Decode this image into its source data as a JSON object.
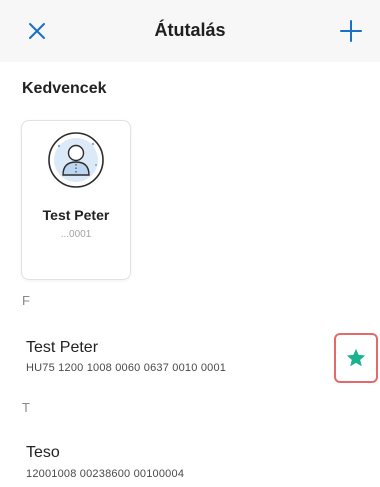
{
  "header": {
    "title": "Átutalás",
    "close_icon": "close-icon",
    "add_icon": "plus-icon",
    "accent_color": "#1a6fc7"
  },
  "favorites": {
    "title": "Kedvencek",
    "items": [
      {
        "name": "Test Peter",
        "account": "...0001",
        "icon": "person-avatar-icon"
      }
    ]
  },
  "contacts": [
    {
      "letter": "F",
      "name": "Test Peter",
      "account": "HU75 1200 1008 0060 0637 0010 0001",
      "favorite": true,
      "star_icon": "star-icon",
      "star_color": "#1bb38f"
    },
    {
      "letter": "T",
      "name": "Teso",
      "account": "12001008 00238600 00100004"
    }
  ]
}
